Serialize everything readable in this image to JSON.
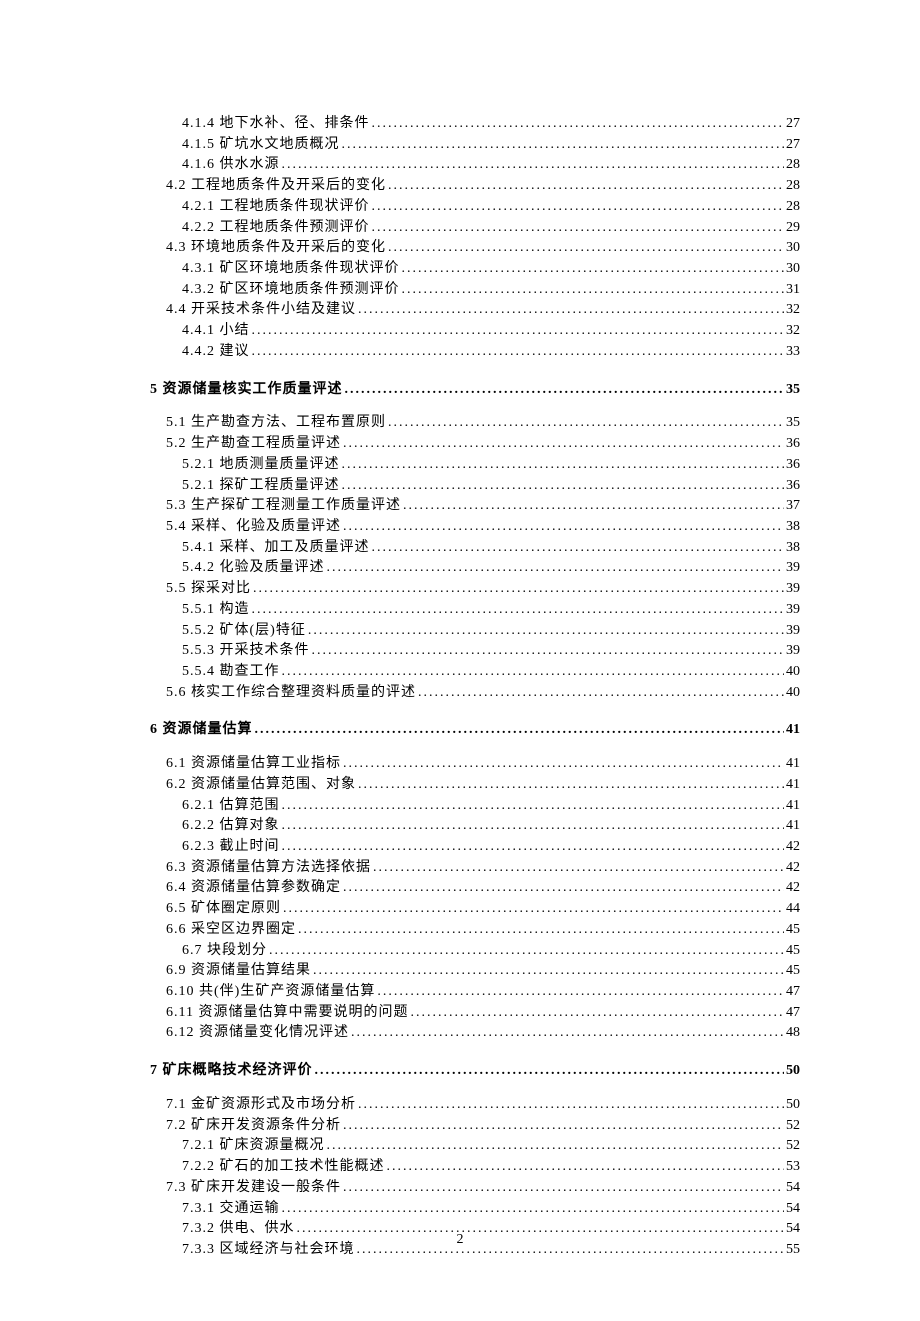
{
  "page_number": "2",
  "toc": [
    {
      "level": 2,
      "label": "4.1.4 地下水补、径、排条件",
      "page": "27",
      "section": false
    },
    {
      "level": 2,
      "label": "4.1.5 矿坑水文地质概况",
      "page": "27",
      "section": false
    },
    {
      "level": 2,
      "label": "4.1.6 供水水源",
      "page": "28",
      "section": false
    },
    {
      "level": 1,
      "label": "4.2 工程地质条件及开采后的变化",
      "page": "28",
      "section": false
    },
    {
      "level": 2,
      "label": "4.2.1 工程地质条件现状评价",
      "page": "28",
      "section": false
    },
    {
      "level": 2,
      "label": "4.2.2 工程地质条件预测评价",
      "page": "29",
      "section": false
    },
    {
      "level": 1,
      "label": "4.3 环境地质条件及开采后的变化",
      "page": "30",
      "section": false
    },
    {
      "level": 2,
      "label": "4.3.1 矿区环境地质条件现状评价",
      "page": "30",
      "section": false
    },
    {
      "level": 2,
      "label": "4.3.2 矿区环境地质条件预测评价",
      "page": "31",
      "section": false
    },
    {
      "level": 1,
      "label": "4.4 开采技术条件小结及建议",
      "page": "32",
      "section": false
    },
    {
      "level": 2,
      "label": "4.4.1 小结",
      "page": "32",
      "section": false
    },
    {
      "level": 2,
      "label": "4.4.2 建议",
      "page": "33",
      "section": false
    },
    {
      "level": 0,
      "label": "5 资源储量核实工作质量评述",
      "page": "35",
      "section": true
    },
    {
      "level": 1,
      "label": "5.1 生产勘查方法、工程布置原则",
      "page": "35",
      "section": false
    },
    {
      "level": 1,
      "label": "5.2 生产勘查工程质量评述",
      "page": "36",
      "section": false
    },
    {
      "level": 2,
      "label": "5.2.1 地质测量质量评述",
      "page": "36",
      "section": false
    },
    {
      "level": 2,
      "label": "5.2.1 探矿工程质量评述",
      "page": "36",
      "section": false
    },
    {
      "level": 1,
      "label": "5.3 生产探矿工程测量工作质量评述",
      "page": "37",
      "section": false
    },
    {
      "level": 1,
      "label": "5.4 采样、化验及质量评述",
      "page": "38",
      "section": false
    },
    {
      "level": 2,
      "label": "5.4.1 采样、加工及质量评述",
      "page": "38",
      "section": false
    },
    {
      "level": 2,
      "label": "5.4.2 化验及质量评述",
      "page": "39",
      "section": false
    },
    {
      "level": 1,
      "label": "5.5 探采对比",
      "page": "39",
      "section": false
    },
    {
      "level": 2,
      "label": "5.5.1 构造",
      "page": "39",
      "section": false
    },
    {
      "level": 2,
      "label": "5.5.2 矿体(层)特征",
      "page": "39",
      "section": false
    },
    {
      "level": 2,
      "label": "5.5.3 开采技术条件",
      "page": "39",
      "section": false
    },
    {
      "level": 2,
      "label": "5.5.4 勘查工作",
      "page": "40",
      "section": false
    },
    {
      "level": 1,
      "label": "5.6 核实工作综合整理资料质量的评述",
      "page": "40",
      "section": false
    },
    {
      "level": 0,
      "label": "6 资源储量估算",
      "page": "41",
      "section": true
    },
    {
      "level": 1,
      "label": "6.1 资源储量估算工业指标",
      "page": "41",
      "section": false
    },
    {
      "level": 1,
      "label": "6.2 资源储量估算范围、对象",
      "page": "41",
      "section": false
    },
    {
      "level": 2,
      "label": "6.2.1 估算范围",
      "page": "41",
      "section": false
    },
    {
      "level": 2,
      "label": "6.2.2 估算对象",
      "page": "41",
      "section": false
    },
    {
      "level": 2,
      "label": "6.2.3 截止时间",
      "page": "42",
      "section": false
    },
    {
      "level": 1,
      "label": "6.3 资源储量估算方法选择依据",
      "page": "42",
      "section": false
    },
    {
      "level": 1,
      "label": "6.4 资源储量估算参数确定",
      "page": "42",
      "section": false
    },
    {
      "level": 1,
      "label": "6.5 矿体圈定原则",
      "page": "44",
      "section": false
    },
    {
      "level": 1,
      "label": "6.6 采空区边界圈定",
      "page": "45",
      "section": false
    },
    {
      "level": 2,
      "label": "6.7 块段划分",
      "page": "45",
      "section": false
    },
    {
      "level": 1,
      "label": "6.9 资源储量估算结果",
      "page": "45",
      "section": false
    },
    {
      "level": 1,
      "label": "6.10 共(伴)生矿产资源储量估算",
      "page": "47",
      "section": false
    },
    {
      "level": 1,
      "label": "6.11 资源储量估算中需要说明的问题",
      "page": "47",
      "section": false
    },
    {
      "level": 1,
      "label": "6.12 资源储量变化情况评述",
      "page": "48",
      "section": false
    },
    {
      "level": 0,
      "label": "7 矿床概略技术经济评价",
      "page": "50",
      "section": true
    },
    {
      "level": 1,
      "label": "7.1 金矿资源形式及市场分析",
      "page": "50",
      "section": false
    },
    {
      "level": 1,
      "label": "7.2 矿床开发资源条件分析",
      "page": "52",
      "section": false
    },
    {
      "level": 2,
      "label": "7.2.1 矿床资源量概况",
      "page": "52",
      "section": false
    },
    {
      "level": 2,
      "label": "7.2.2 矿石的加工技术性能概述",
      "page": "53",
      "section": false
    },
    {
      "level": 1,
      "label": "7.3 矿床开发建设一般条件",
      "page": "54",
      "section": false
    },
    {
      "level": 2,
      "label": "7.3.1 交通运输",
      "page": "54",
      "section": false
    },
    {
      "level": 2,
      "label": "7.3.2 供电、供水",
      "page": "54",
      "section": false
    },
    {
      "level": 2,
      "label": "7.3.3 区域经济与社会环境",
      "page": "55",
      "section": false
    }
  ]
}
